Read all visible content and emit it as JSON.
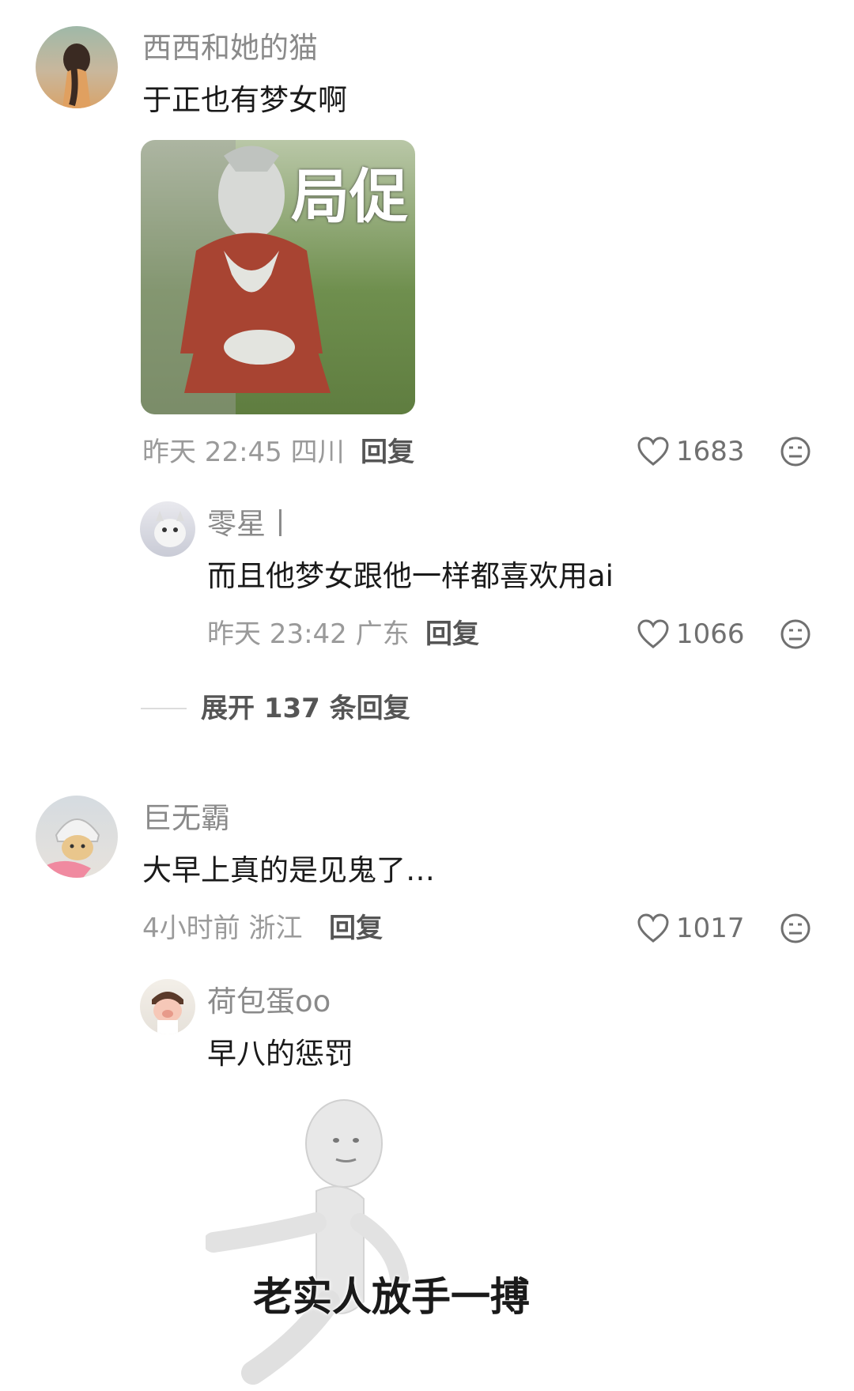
{
  "comments": [
    {
      "user": "西西和她的猫",
      "text": "于正也有梦女啊",
      "sticker_caption": "局促",
      "time": "昨天 22:45",
      "location": "四川",
      "reply_label": "回复",
      "likes": "1683",
      "replies": [
        {
          "user": "零星丨",
          "text": "而且他梦女跟他一样都喜欢用ai",
          "time": "昨天 23:42",
          "location": "广东",
          "reply_label": "回复",
          "likes": "1066"
        }
      ],
      "expand_label": "展开 137 条回复"
    },
    {
      "user": "巨无霸",
      "text": "大早上真的是见鬼了…",
      "time": "4小时前",
      "location": "浙江",
      "reply_label": "回复",
      "likes": "1017",
      "replies": [
        {
          "user": "荷包蛋oo",
          "text": "早八的惩罚",
          "sticker_caption": "老实人放手一搏"
        }
      ]
    }
  ],
  "icons": {
    "like": "heart-outline-icon",
    "reaction": "neutral-face-icon"
  },
  "colors": {
    "username": "#8a8a8a",
    "text": "#1a1a1a",
    "meta": "#9a9a9a"
  }
}
